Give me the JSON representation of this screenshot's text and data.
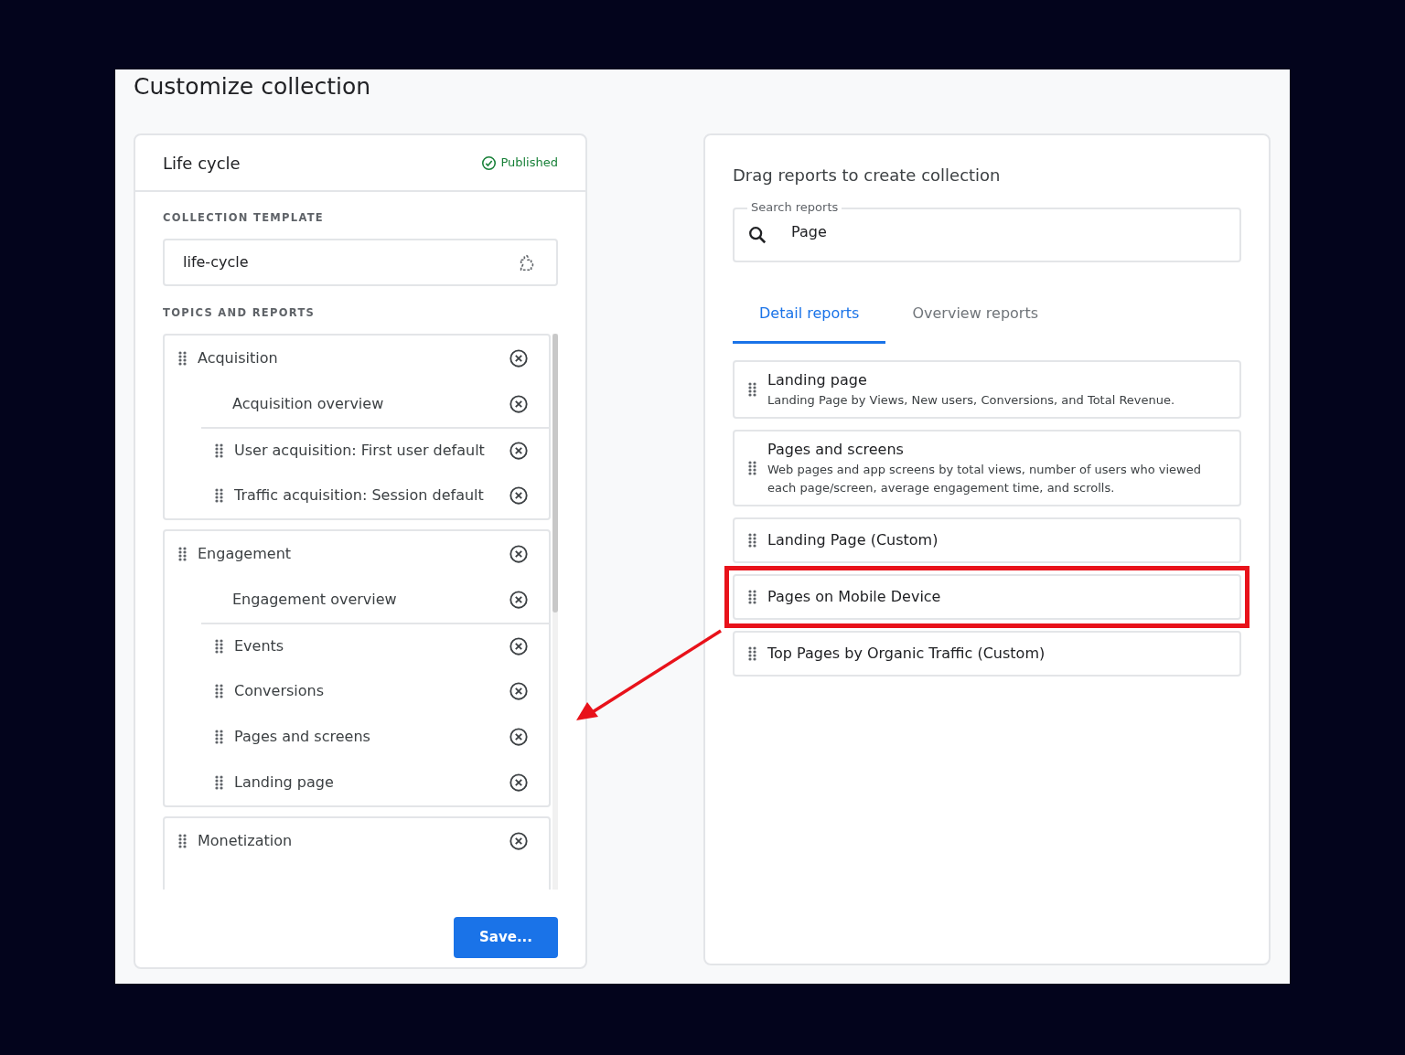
{
  "title": "Customize collection",
  "collection": {
    "name": "Life cycle",
    "status": "Published",
    "template_label": "COLLECTION TEMPLATE",
    "template_value": "life-cycle",
    "topics_label": "TOPICS AND REPORTS",
    "topics": [
      {
        "name": "Acquisition",
        "items": [
          {
            "kind": "overview",
            "name": "Acquisition overview"
          },
          {
            "kind": "report",
            "name": "User acquisition: First user default"
          },
          {
            "kind": "report",
            "name": "Traffic acquisition: Session default"
          }
        ]
      },
      {
        "name": "Engagement",
        "items": [
          {
            "kind": "overview",
            "name": "Engagement overview"
          },
          {
            "kind": "report",
            "name": "Events"
          },
          {
            "kind": "report",
            "name": "Conversions"
          },
          {
            "kind": "report",
            "name": "Pages and screens"
          },
          {
            "kind": "report",
            "name": "Landing page"
          }
        ]
      },
      {
        "name": "Monetization"
      }
    ],
    "save_button": "Save..."
  },
  "library": {
    "heading": "Drag reports to create collection",
    "search": {
      "label": "Search reports",
      "value": "Page"
    },
    "tabs": [
      {
        "label": "Detail reports",
        "selected": true
      },
      {
        "label": "Overview reports",
        "selected": false
      }
    ],
    "reports": [
      {
        "name": "Landing page",
        "description": "Landing Page by Views, New users, Conversions, and Total Revenue.",
        "highlighted": false
      },
      {
        "name": "Pages and screens",
        "description": "Web pages and app screens by total views, number of users who viewed each page/screen, average engagement time, and scrolls.",
        "highlighted": false
      },
      {
        "name": "Landing Page (Custom)",
        "highlighted": false
      },
      {
        "name": "Pages on Mobile Device",
        "highlighted": true
      },
      {
        "name": "Top Pages by Organic Traffic (Custom)",
        "highlighted": false
      }
    ]
  }
}
